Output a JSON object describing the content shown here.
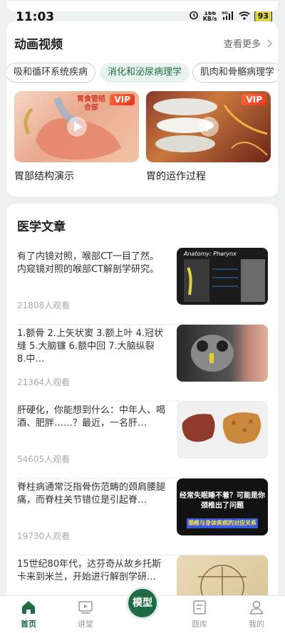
{
  "status": {
    "time": "11:03",
    "net_speed_value": "166",
    "net_speed_unit": "KB/s",
    "network": "5G",
    "battery": "93"
  },
  "videos": {
    "title": "动画视频",
    "more_label": "查看更多",
    "tags": [
      "吸和循环系统疾病",
      "消化和泌尿病理学",
      "肌肉和骨骼病理学"
    ],
    "active_tag_index": 1,
    "items": [
      {
        "title": "胃部结构演示",
        "badge": "VIP",
        "thumb_label": "胃食管结合部"
      },
      {
        "title": "胃的运作过程",
        "badge": "VIP"
      }
    ]
  },
  "articles": {
    "title": "医学文章",
    "items": [
      {
        "text": "有了内镜对照，喉部CT一目了然。内窥镜对照的喉部CT解剖学研究。",
        "views": "21808人观看",
        "thumb_caption": "Anatomy: Pharynx"
      },
      {
        "text": "1.额骨 2.上矢状窦 3.额上叶 4.冠状缝 5.大脑镰 6.额中回 7.大脑纵裂 8.中…",
        "views": "21364人观看"
      },
      {
        "text": "肝硬化，你能想到什么：中年人、喝酒、肥胖……？最近，一名肝…",
        "views": "54605人观看"
      },
      {
        "text": "脊柱病通常泛指骨伤范畴的颈肩腰腿痛，而脊柱关节错位是引起脊…",
        "views": "19730人观看",
        "thumb_caption": "经常失眠睡不着？可能是你颈椎出了问题",
        "thumb_subcaption": "颈椎与身体疾病的对应关系"
      },
      {
        "text": "15世纪80年代，达芬奇从故乡托斯卡来到米兰，开始进行解剖学研…",
        "views": ""
      }
    ]
  },
  "tabbar": {
    "tabs": [
      {
        "label": "首页",
        "icon": "home-icon"
      },
      {
        "label": "讲堂",
        "icon": "video-icon"
      },
      {
        "label": "模型",
        "icon": "model-icon"
      },
      {
        "label": "题库",
        "icon": "question-bank-icon"
      },
      {
        "label": "我的",
        "icon": "profile-icon"
      }
    ],
    "center_label": "模型",
    "active_index": 0
  },
  "colors": {
    "accent": "#1f6b43",
    "active_tag_bg": "#e7f3ec",
    "vip": "#e8361c",
    "background": "#eef1ef"
  }
}
